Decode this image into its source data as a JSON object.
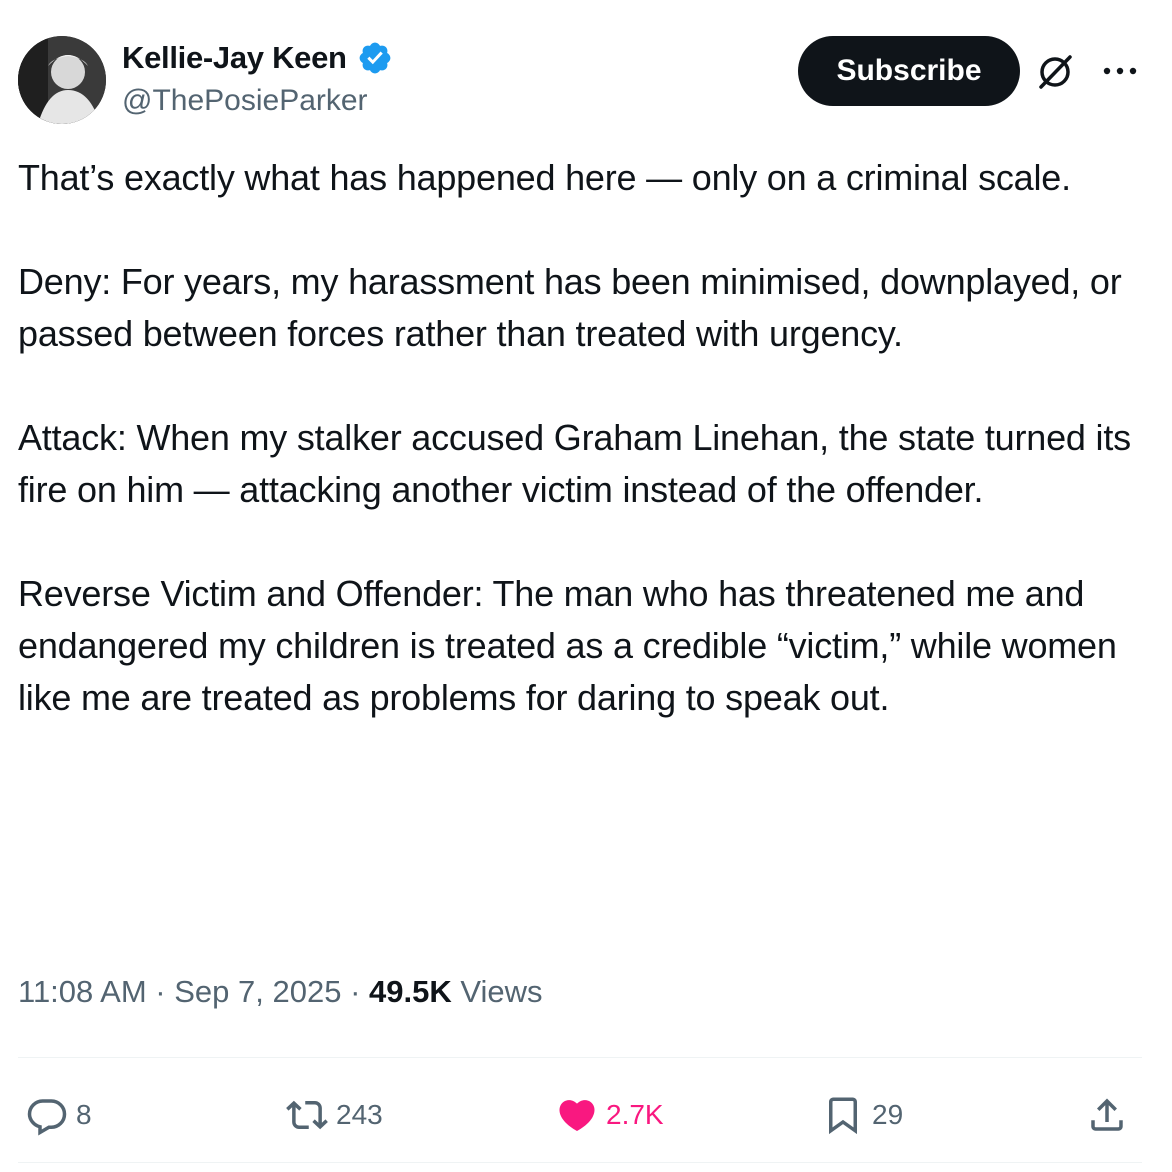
{
  "author": {
    "display_name": "Kellie-Jay Keen",
    "handle": "@ThePosieParker",
    "verified": true,
    "verified_color": "#1d9bf0"
  },
  "header": {
    "subscribe_label": "Subscribe",
    "grok_icon": "grok-icon",
    "more_icon": "more-dots-icon"
  },
  "tweet": {
    "paragraphs": [
      "That’s exactly what has happened here — only on a criminal scale.",
      "Deny: For years, my harassment has been minimised, downplayed, or passed between forces rather than treated with urgency.",
      "Attack: When my stalker accused Graham Linehan, the state turned its fire on him — attacking another victim instead of the offender.",
      "Reverse Victim and Offender: The man who has threatened me and endangered my children is treated as a credible “victim,” while women like me are treated as problems for daring to speak out."
    ]
  },
  "meta": {
    "time": "11:08 AM",
    "separator": " · ",
    "date": "Sep 7, 2025",
    "views_count": "49.5K",
    "views_label": " Views"
  },
  "actions": {
    "replies": "8",
    "reposts": "243",
    "likes": "2.7K",
    "bookmarks": "29",
    "like_color": "#f91880",
    "muted_color": "#536471"
  }
}
